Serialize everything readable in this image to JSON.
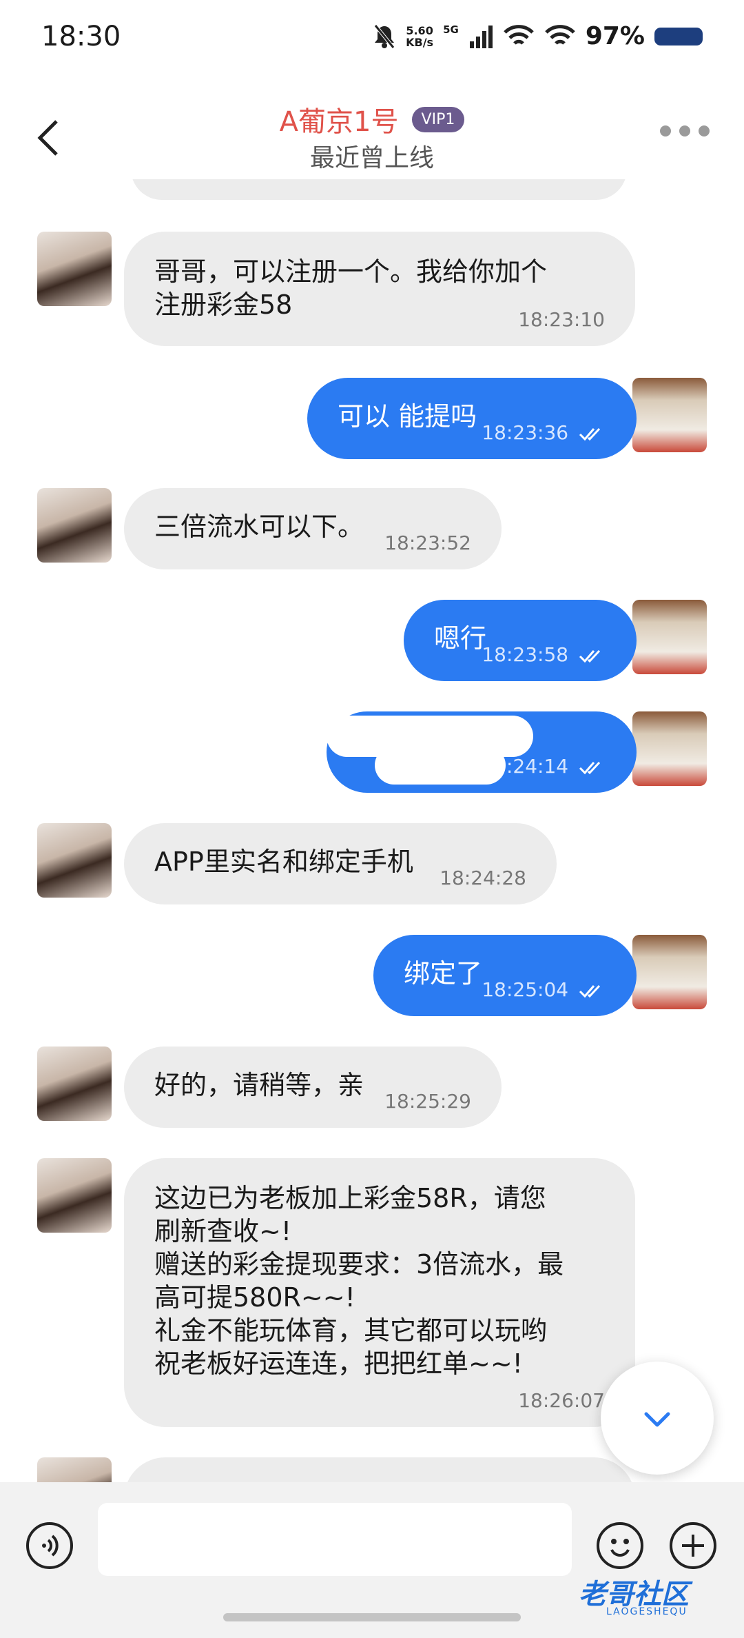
{
  "status_bar": {
    "time": "18:30",
    "net_speed_value": "5.60",
    "net_speed_unit": "KB/s",
    "signal_label": "5G",
    "battery": "97%"
  },
  "header": {
    "title": "A葡京1号",
    "badge": "VIP1",
    "subtitle": "最近曾上线"
  },
  "messages": [
    {
      "side": "in",
      "text": "哥哥，可以注册一个。我给你加个\n注册彩金58",
      "time": "18:23:10"
    },
    {
      "side": "out",
      "text": "可以 能提吗",
      "time": "18:23:36"
    },
    {
      "side": "in",
      "text": "三倍流水可以下。",
      "time": "18:23:52"
    },
    {
      "side": "out",
      "text": "嗯行",
      "time": "18:23:58"
    },
    {
      "side": "out",
      "text": "",
      "time": ":24:14"
    },
    {
      "side": "in",
      "text": "APP里实名和绑定手机",
      "time": "18:24:28"
    },
    {
      "side": "out",
      "text": "绑定了",
      "time": "18:25:04"
    },
    {
      "side": "in",
      "text": "好的，请稍等，亲",
      "time": "18:25:29"
    },
    {
      "side": "in",
      "text": "这边已为老板加上彩金58R，请您\n刷新查收~!\n赠送的彩金提现要求：3倍流水，最\n高可提580R~~!\n礼金不能玩体育，其它都可以玩哟\n祝老板好运连连，把把红单~~!",
      "time": "18:26:07"
    }
  ],
  "watermark": {
    "text": "老哥社区",
    "sub": "LAOGESHEQU"
  },
  "colors": {
    "accent": "#2b7bf2",
    "incoming": "#ececec",
    "title": "#e0524a",
    "vip": "#6b5b8e"
  }
}
